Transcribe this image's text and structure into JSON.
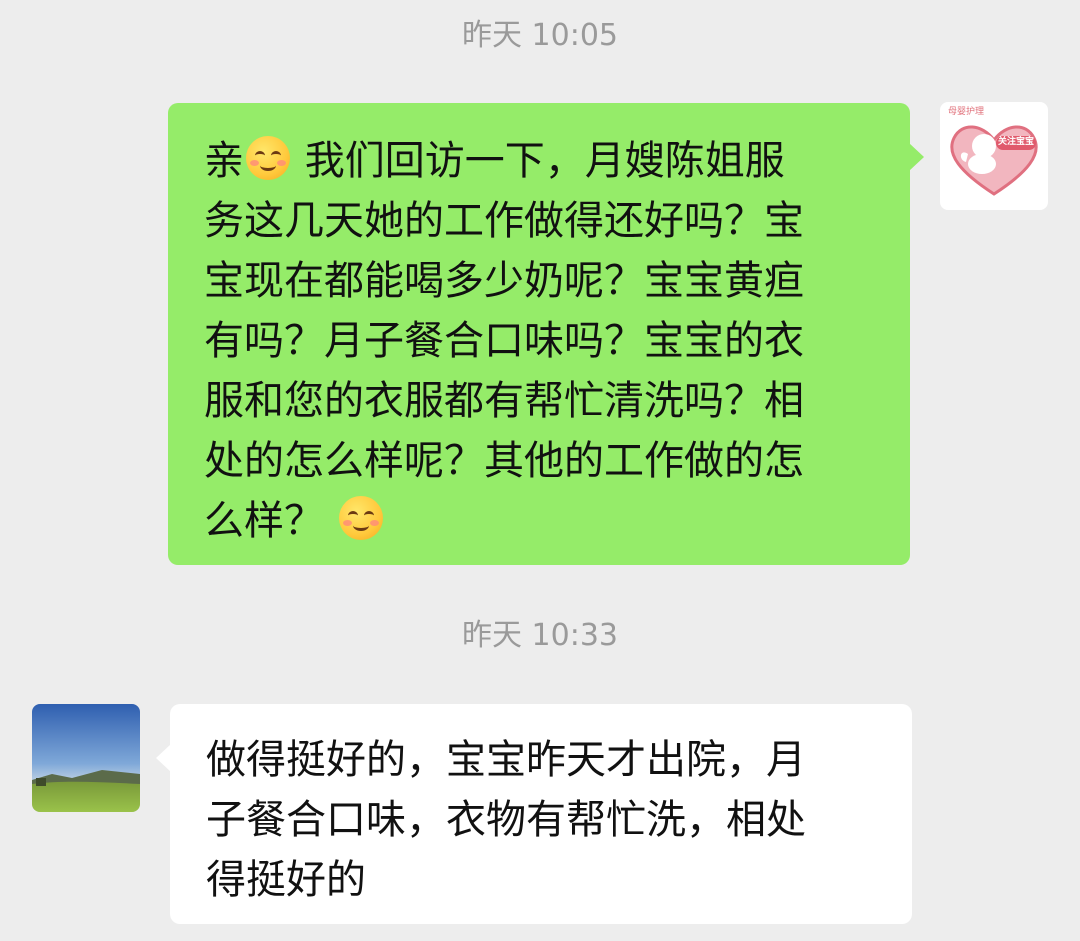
{
  "messages": [
    {
      "timestamp": "昨天 10:05",
      "direction": "outgoing",
      "lines": [
        [
          "亲",
          "",
          "我们回访一下，月嫂陈姐服"
        ],
        "务这几天她的工作做得还好吗？宝",
        "宝现在都能喝多少奶呢？宝宝黄疸",
        "有吗？月子餐合口味吗？宝宝的衣",
        "服和您的衣服都有帮忙清洗吗？相",
        "处的怎么样呢？其他的工作做的怎",
        [
          "么样？",
          ""
        ]
      ],
      "emoji": "smiling-face-icon",
      "avatar": {
        "tag": "母婴护理",
        "badge": "关注宝宝"
      }
    },
    {
      "timestamp": "昨天 10:33",
      "direction": "incoming",
      "lines": [
        "做得挺好的，宝宝昨天才出院，月",
        "子餐合口味，衣物有帮忙洗，相处",
        "得挺好的"
      ],
      "avatar": "landscape-avatar"
    }
  ],
  "colors": {
    "background": "#ededed",
    "outgoing_bubble": "#95ec69",
    "incoming_bubble": "#ffffff",
    "timestamp": "#9a9a9a"
  }
}
